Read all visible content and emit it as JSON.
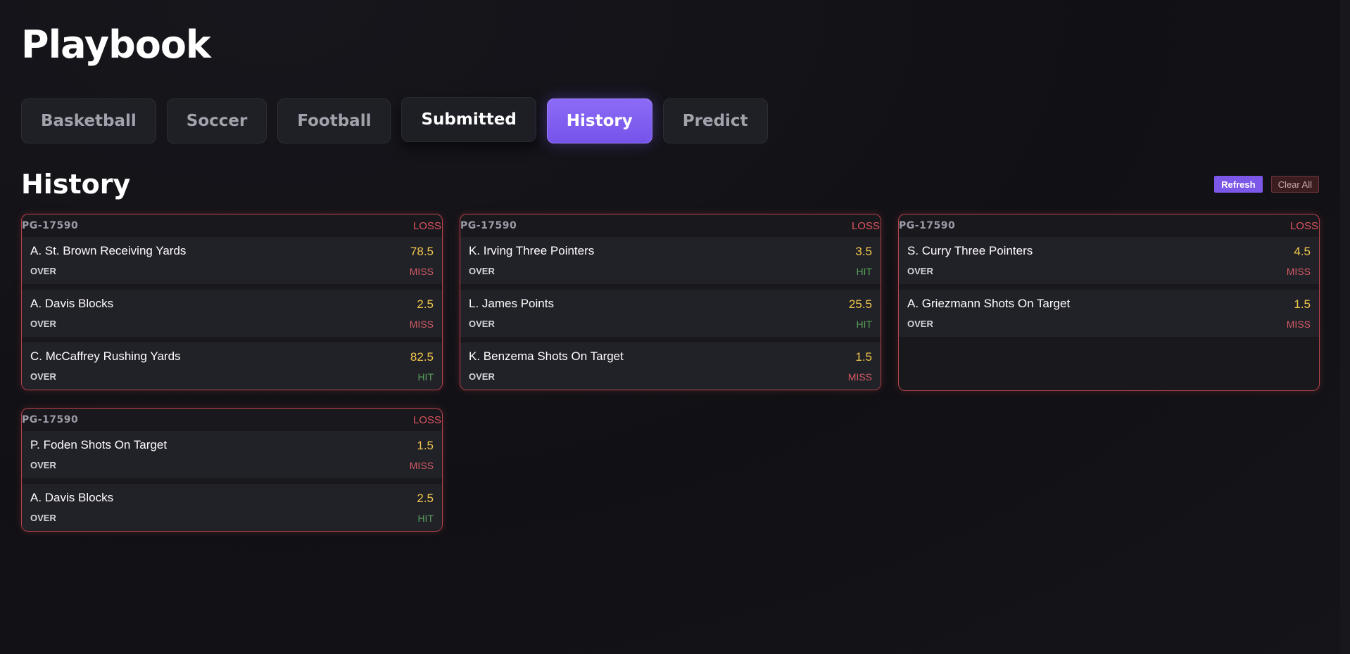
{
  "app": {
    "title": "Playbook"
  },
  "tabs": [
    {
      "label": "Basketball",
      "state": "default"
    },
    {
      "label": "Soccer",
      "state": "default"
    },
    {
      "label": "Football",
      "state": "default"
    },
    {
      "label": "Submitted",
      "state": "raised"
    },
    {
      "label": "History",
      "state": "active"
    },
    {
      "label": "Predict",
      "state": "default"
    }
  ],
  "section": {
    "title": "History",
    "refresh_label": "Refresh",
    "clear_label": "Clear All"
  },
  "colors": {
    "accent": "#7c58e8",
    "loss": "#e05461",
    "hit": "#58a05a",
    "miss": "#d35b65",
    "line": "#f2c84b"
  },
  "cards": [
    {
      "id": "PG-17590",
      "result": "LOSS",
      "legs": [
        {
          "name": "A. St. Brown Receiving Yards",
          "line": "78.5",
          "direction": "OVER",
          "outcome": "MISS"
        },
        {
          "name": "A. Davis Blocks",
          "line": "2.5",
          "direction": "OVER",
          "outcome": "MISS"
        },
        {
          "name": "C. McCaffrey Rushing Yards",
          "line": "82.5",
          "direction": "OVER",
          "outcome": "HIT"
        }
      ]
    },
    {
      "id": "PG-17590",
      "result": "LOSS",
      "legs": [
        {
          "name": "K. Irving Three Pointers",
          "line": "3.5",
          "direction": "OVER",
          "outcome": "HIT"
        },
        {
          "name": "L. James Points",
          "line": "25.5",
          "direction": "OVER",
          "outcome": "HIT"
        },
        {
          "name": "K. Benzema Shots On Target",
          "line": "1.5",
          "direction": "OVER",
          "outcome": "MISS"
        }
      ]
    },
    {
      "id": "PG-17590",
      "result": "LOSS",
      "legs": [
        {
          "name": "S. Curry Three Pointers",
          "line": "4.5",
          "direction": "OVER",
          "outcome": "MISS"
        },
        {
          "name": "A. Griezmann Shots On Target",
          "line": "1.5",
          "direction": "OVER",
          "outcome": "MISS"
        }
      ]
    },
    {
      "id": "PG-17590",
      "result": "LOSS",
      "legs": [
        {
          "name": "P. Foden Shots On Target",
          "line": "1.5",
          "direction": "OVER",
          "outcome": "MISS"
        },
        {
          "name": "A. Davis Blocks",
          "line": "2.5",
          "direction": "OVER",
          "outcome": "HIT"
        }
      ]
    }
  ]
}
